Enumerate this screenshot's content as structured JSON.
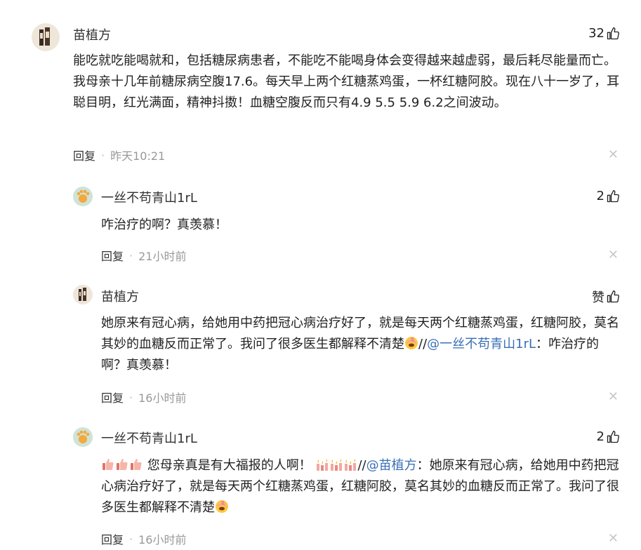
{
  "comments": [
    {
      "name": "苗植方",
      "likes": "32",
      "text": "能吃就吃能喝就和，包括糖尿病患者，不能吃不能喝身体会变得越来越虚弱，最后耗尽能量而亡。我母亲十几年前糖尿病空腹17.6。每天早上两个红糖蒸鸡蛋，一杯红糖阿胶。现在八十一岁了，耳聪目明，红光满面，精神抖擞！血糖空腹反而只有4.9 5.5 5.9 6.2之间波动。",
      "reply": "回复",
      "time": "昨天10:21"
    },
    {
      "name": "一丝不苟青山1rL",
      "likes": "2",
      "text": "咋治疗的啊？真羡慕！",
      "reply": "回复",
      "time": "21小时前"
    },
    {
      "name": "苗植方",
      "likes": "赞",
      "text_a": "她原来有冠心病，给她用中药把冠心病治疗好了，就是每天两个红糖蒸鸡蛋，红糖阿胶，莫名其妙的血糖反而正常了。我问了很多医生都解释不清楚",
      "slashes": "//",
      "mention": "@一丝不苟青山1rL",
      "text_b": "：咋治疗的啊？真羡慕！",
      "reply": "回复",
      "time": "16小时前"
    },
    {
      "name": "一丝不苟青山1rL",
      "likes": "2",
      "text_a": "您母亲真是有大福报的人啊！",
      "slashes": "//",
      "mention": "@苗植方",
      "text_b": "：她原来有冠心病，给她用中药把冠心病治疗好了，就是每天两个红糖蒸鸡蛋，红糖阿胶，莫名其妙的血糖反而正常了。我问了很多医生都解释不清楚",
      "reply": "回复",
      "time": "16小时前"
    }
  ],
  "icons": {
    "like": "thumbs-up-icon",
    "close": "close-icon",
    "emoji_facepalm": "facepalm-emoji",
    "emoji_thumb": "thumbs-up-emoji",
    "emoji_candle": "candle-emoji"
  },
  "colors": {
    "mention": "#3a6fb5",
    "muted": "#999999"
  }
}
